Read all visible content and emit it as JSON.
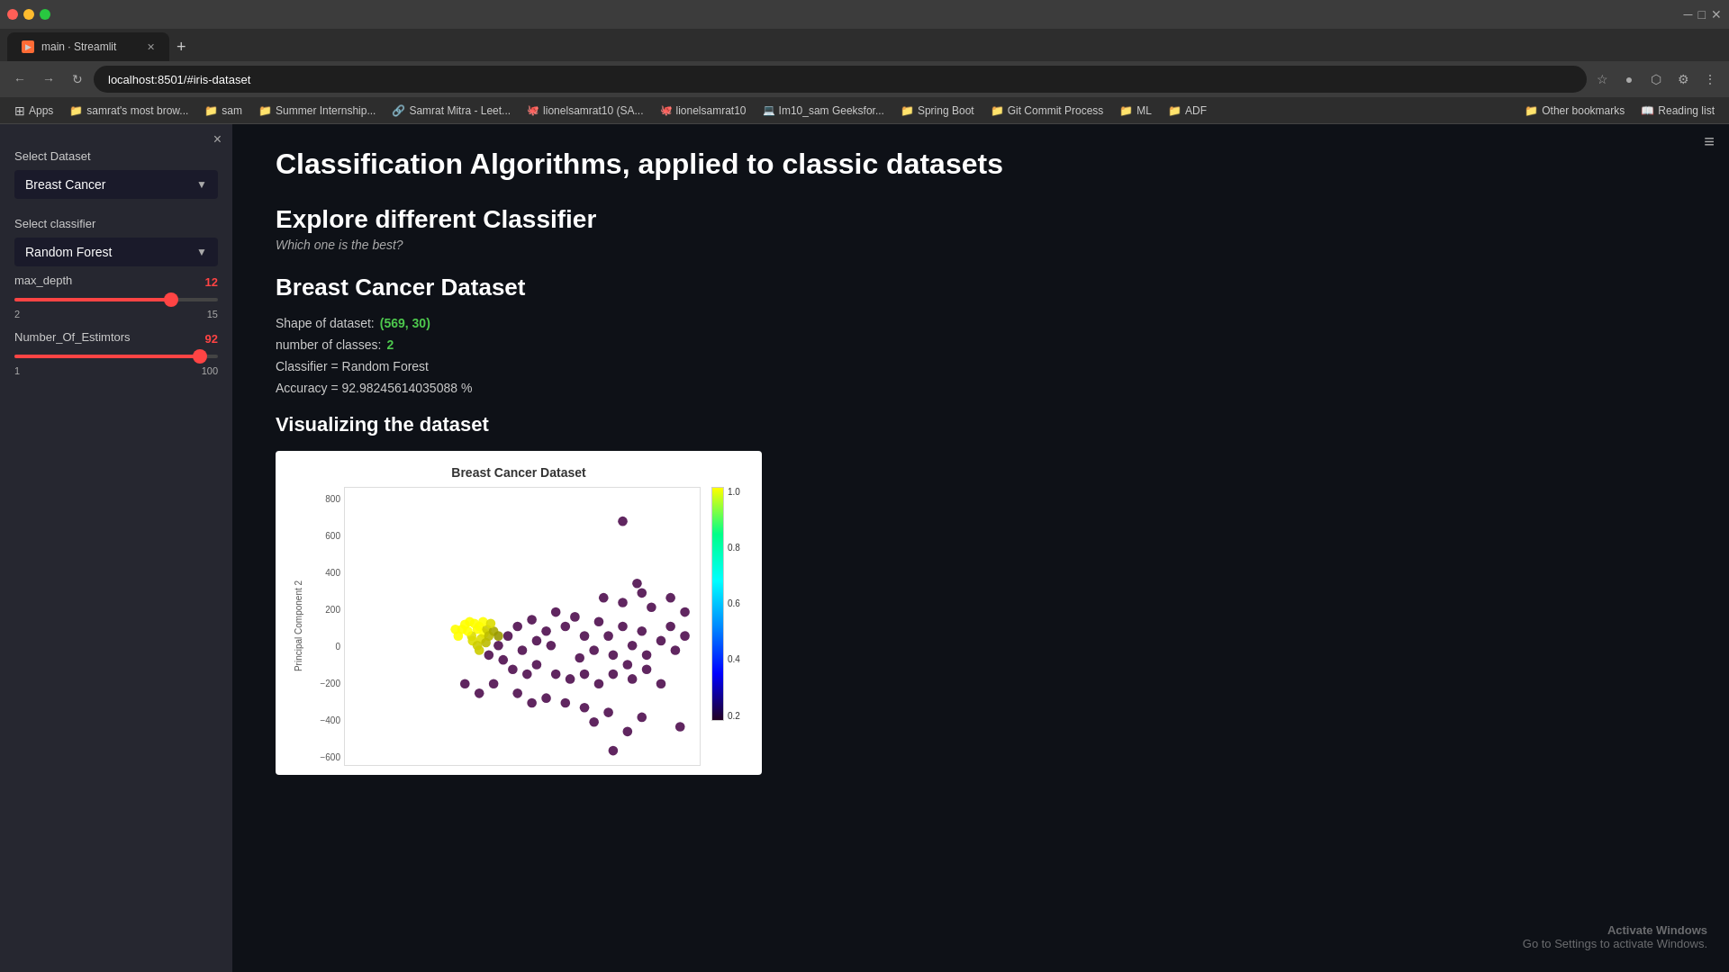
{
  "browser": {
    "tab_title": "main · Streamlit",
    "tab_favicon": "▶",
    "url": "localhost:8501/#iris-dataset",
    "new_tab_label": "+",
    "controls": {
      "back": "←",
      "forward": "→",
      "refresh": "↺",
      "home": "⌂"
    },
    "browser_icons": [
      "★",
      "🔒",
      "⊕",
      "⋯"
    ]
  },
  "bookmarks": [
    {
      "label": "Apps",
      "type": "apps"
    },
    {
      "label": "samrat's most brow...",
      "type": "folder"
    },
    {
      "label": "sam",
      "type": "folder"
    },
    {
      "label": "Summer Internship...",
      "type": "folder"
    },
    {
      "label": "Samrat Mitra - Leet...",
      "type": "link"
    },
    {
      "label": "lionelsamrat10 (SA...",
      "type": "link"
    },
    {
      "label": "lionelsamrat10",
      "type": "link"
    },
    {
      "label": "Im10_sam Geeksfor...",
      "type": "link"
    },
    {
      "label": "Spring Boot",
      "type": "folder"
    },
    {
      "label": "Git Commit Process",
      "type": "folder"
    },
    {
      "label": "ML",
      "type": "folder"
    },
    {
      "label": "ADF",
      "type": "folder"
    },
    {
      "label": "Other bookmarks",
      "type": "folder"
    },
    {
      "label": "Reading list",
      "type": "folder"
    }
  ],
  "sidebar": {
    "close_icon": "×",
    "dataset_label": "Select Dataset",
    "dataset_value": "Breast Cancer",
    "classifier_label": "Select classifier",
    "classifier_value": "Random Forest",
    "max_depth_label": "max_depth",
    "max_depth_value": "12",
    "max_depth_min": "2",
    "max_depth_max": "15",
    "max_depth_pct": 77,
    "estimators_label": "Number_Of_Estimtors",
    "estimators_value": "92",
    "estimators_min": "1",
    "estimators_max": "100",
    "estimators_pct": 91
  },
  "main": {
    "page_title": "Classification Algorithms, applied to classic datasets",
    "section_title": "Explore different Classifier",
    "section_subtitle": "Which one is the best?",
    "dataset_title": "Breast Cancer Dataset",
    "shape_label": "Shape of dataset:",
    "shape_value": "(569, 30)",
    "classes_label": "number of classes:",
    "classes_value": "2",
    "classifier_label": "Classifier = Random Forest",
    "accuracy_label": "Accuracy = 92.98245614035088 %",
    "viz_title": "Visualizing the dataset",
    "chart_title": "Breast Cancer Dataset",
    "y_axis_label": "Principal Component 2",
    "y_axis_ticks": [
      "800",
      "600",
      "400",
      "200",
      "0",
      "−200",
      "−400",
      "−600"
    ],
    "colorbar_labels": [
      "1.0",
      "0.8",
      "0.6",
      "0.4",
      "0.2"
    ],
    "hamburger_icon": "≡"
  }
}
